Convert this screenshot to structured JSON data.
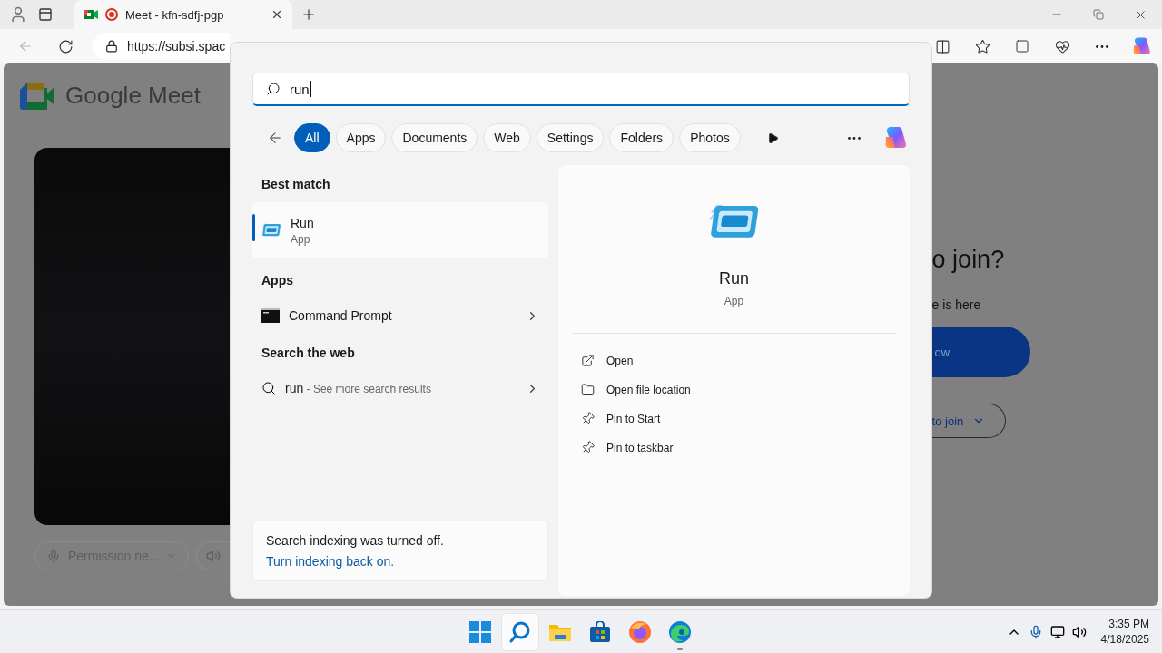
{
  "browser": {
    "can_go_back": false,
    "tabs": [
      {
        "title": "Meet - kfn-sdfj-pgp",
        "selected": true,
        "recording": true
      }
    ],
    "address": "https://subsi.spac"
  },
  "page": {
    "title": "Google Meet",
    "mic_control": "Permission ne...",
    "heading": "o join?",
    "subtext": "e is here",
    "primary_button": "ow",
    "secondary_button": "to join"
  },
  "search": {
    "query": "run",
    "filters": [
      {
        "label": "All",
        "selected": true
      },
      {
        "label": "Apps",
        "selected": false
      },
      {
        "label": "Documents",
        "selected": false
      },
      {
        "label": "Web",
        "selected": false
      },
      {
        "label": "Settings",
        "selected": false
      },
      {
        "label": "Folders",
        "selected": false
      },
      {
        "label": "Photos",
        "selected": false
      }
    ],
    "best_match_header": "Best match",
    "best_match": {
      "title": "Run",
      "subtitle": "App",
      "selected": true
    },
    "apps_header": "Apps",
    "apps": [
      {
        "title": "Command Prompt"
      }
    ],
    "web_header": "Search the web",
    "web": {
      "query": "run",
      "hint": " - See more search results"
    },
    "notice": {
      "text": "Search indexing was turned off.",
      "link": "Turn indexing back on."
    },
    "detail": {
      "title": "Run",
      "subtitle": "App",
      "actions": [
        {
          "kind": "open",
          "label": "Open"
        },
        {
          "kind": "folder",
          "label": "Open file location"
        },
        {
          "kind": "pin",
          "label": "Pin to Start"
        },
        {
          "kind": "pin",
          "label": "Pin to taskbar"
        }
      ]
    }
  },
  "taskbar": {
    "apps": [
      {
        "kind": "start",
        "active": false,
        "running": false
      },
      {
        "kind": "search",
        "active": true,
        "running": false
      },
      {
        "kind": "files",
        "active": false,
        "running": false
      },
      {
        "kind": "store",
        "active": false,
        "running": false
      },
      {
        "kind": "firefox",
        "active": false,
        "running": false
      },
      {
        "kind": "edge",
        "active": false,
        "running": true
      }
    ],
    "time": "3:35 PM",
    "date": "4/18/2025"
  }
}
